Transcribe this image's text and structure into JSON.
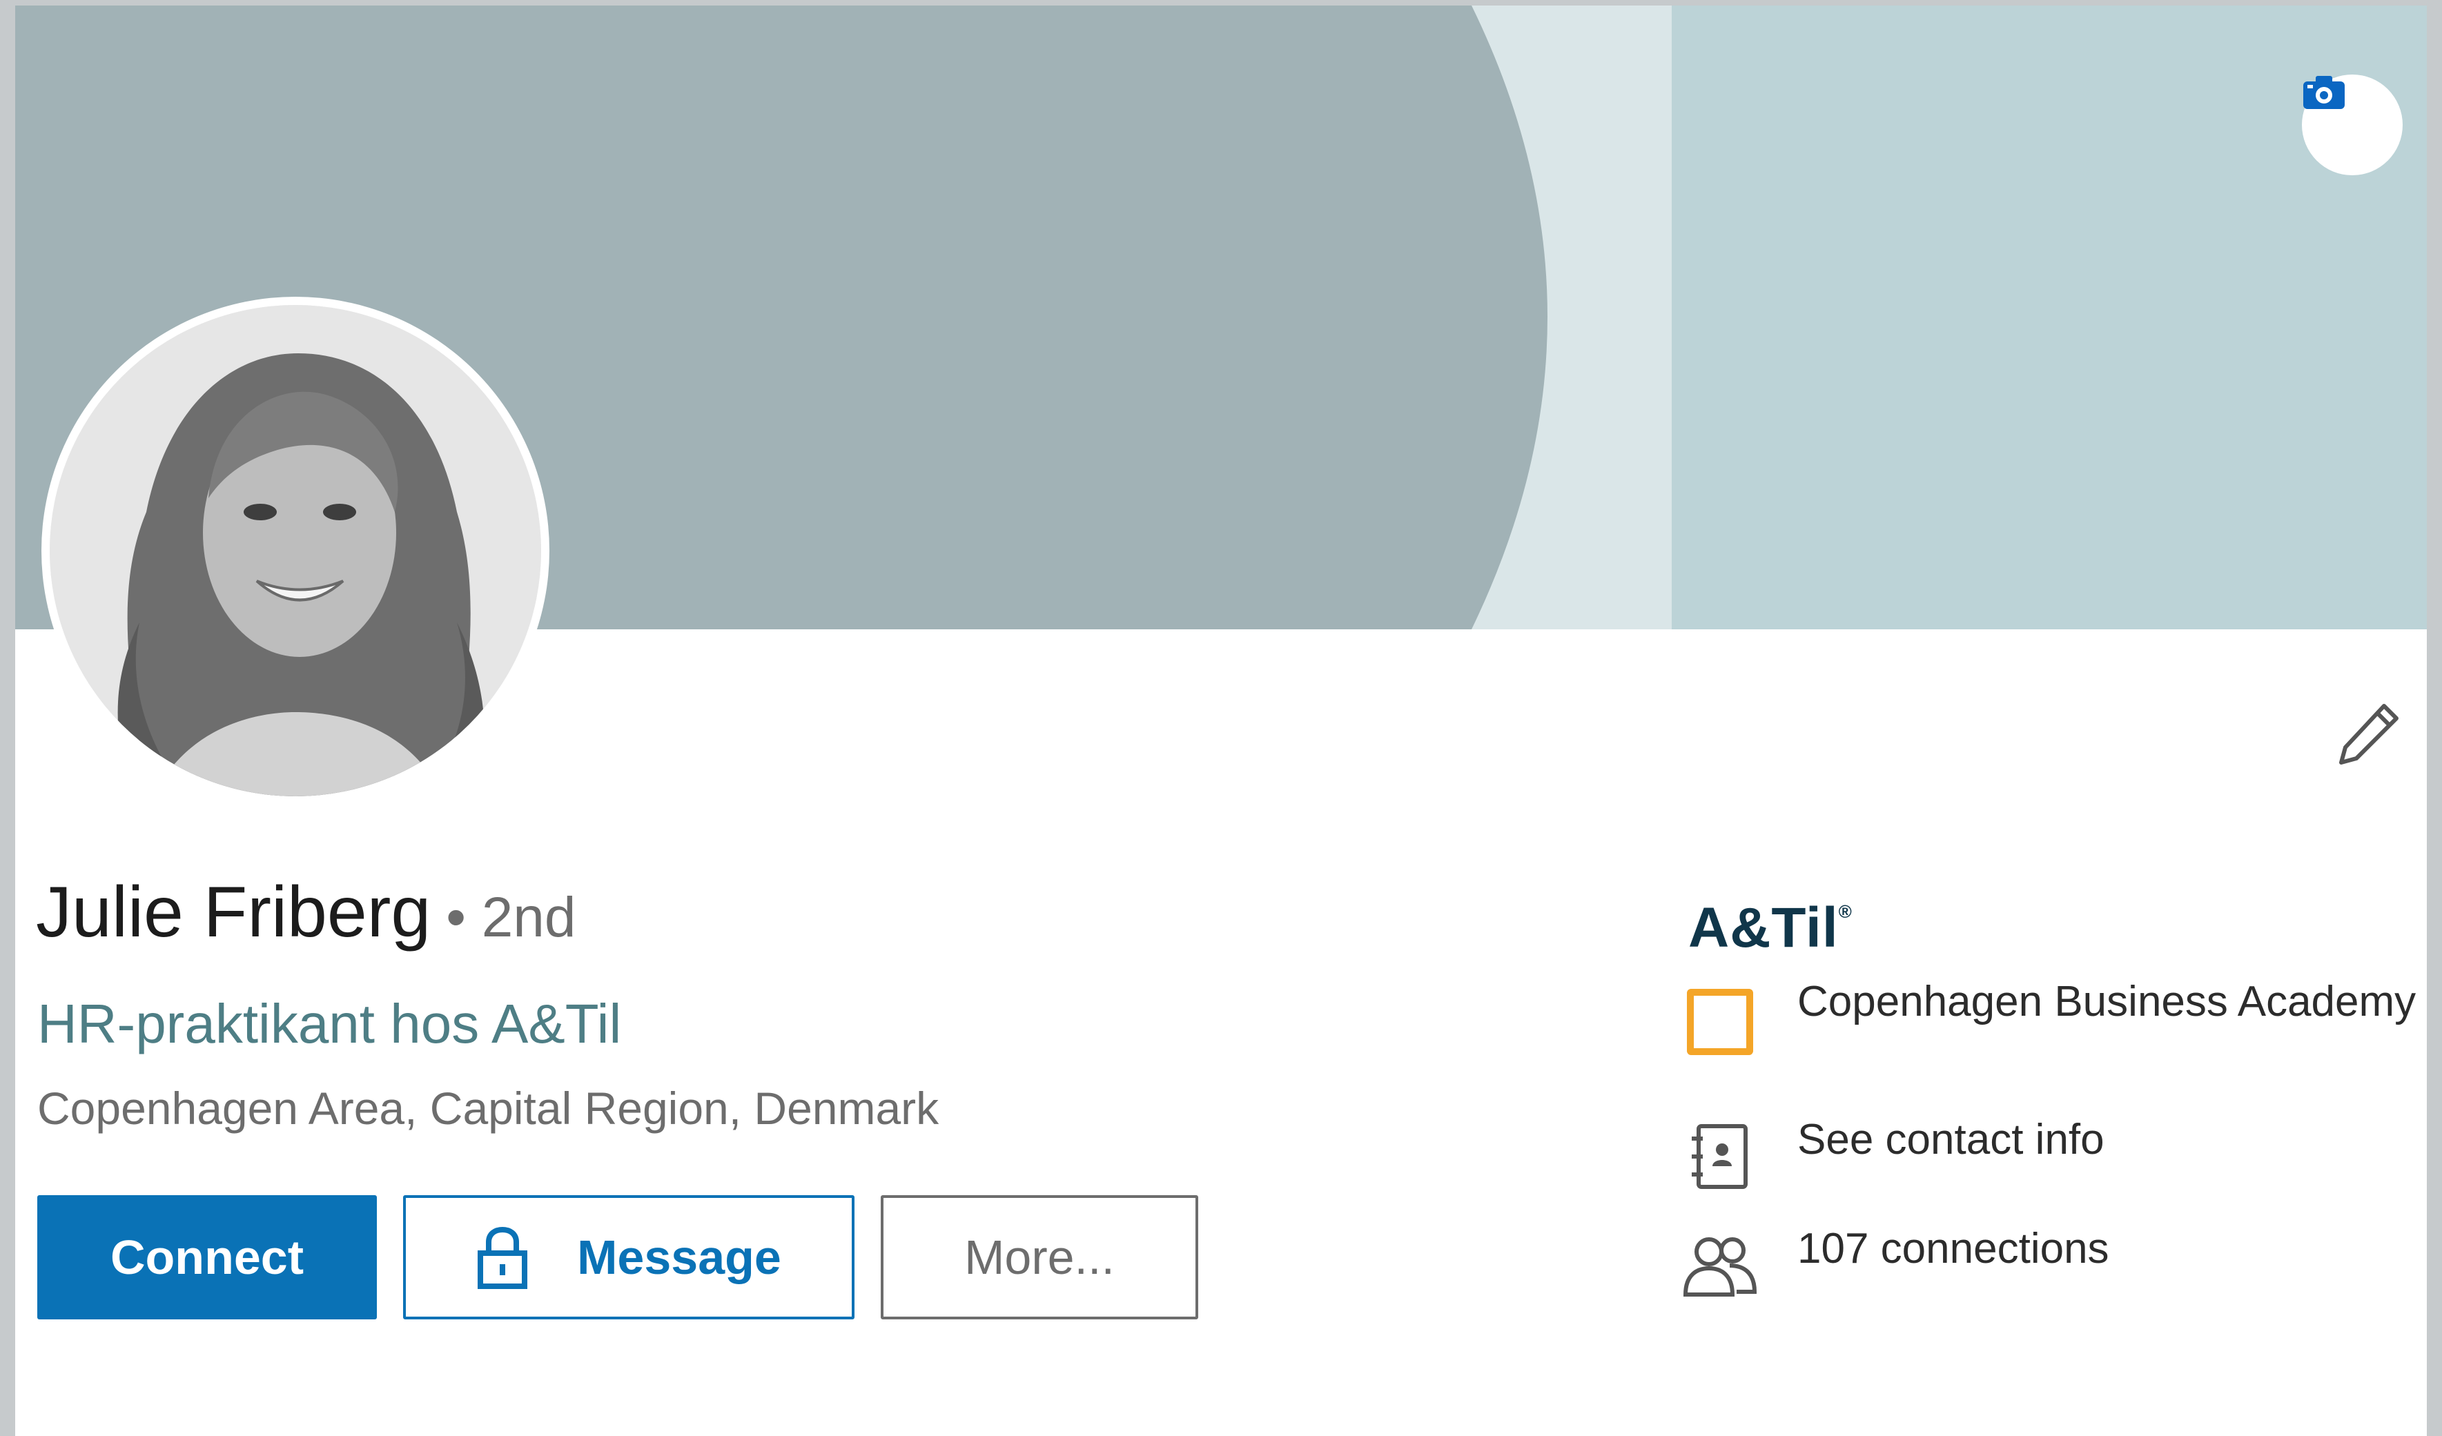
{
  "profile": {
    "name": "Julie Friberg",
    "degree": "• 2nd",
    "headline": "HR-praktikant hos A&Til",
    "location": "Copenhagen Area, Capital Region, Denmark"
  },
  "actions": {
    "connect_label": "Connect",
    "message_label": "Message",
    "more_label": "More..."
  },
  "sidebar": {
    "company_logo_text": "A&Til",
    "company_logo_mark": "®",
    "school": "Copenhagen Business Academy",
    "contact_info_label": "See contact info",
    "connections_label": "107 connections"
  },
  "icons": {
    "banner_camera": "camera-icon",
    "edit": "pencil-icon",
    "message_lock": "lock-icon",
    "school_logo": "school-logo-icon",
    "contact": "address-book-icon",
    "connections": "people-icon"
  },
  "colors": {
    "primary": "#0a72b6",
    "headline": "#4e7e85",
    "banner_dark": "#a1b2b6",
    "banner_light": "#dae6e8",
    "banner_mid": "#bcd3d7",
    "school_accent": "#f4a528"
  }
}
